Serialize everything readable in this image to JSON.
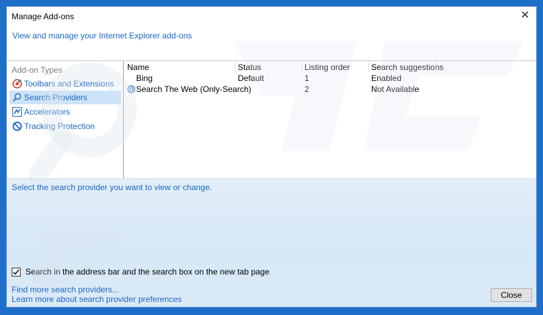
{
  "window": {
    "title": "Manage Add-ons",
    "close_glyph": "✕",
    "header_link": "View and manage your Internet Explorer add-ons"
  },
  "sidebar": {
    "heading": "Add-on Types",
    "items": [
      {
        "label": "Toolbars and Extensions",
        "icon": "toolbar-extensions-icon",
        "selected": false
      },
      {
        "label": "Search Providers",
        "icon": "search-icon",
        "selected": true
      },
      {
        "label": "Accelerators",
        "icon": "accelerator-icon",
        "selected": false
      },
      {
        "label": "Tracking Protection",
        "icon": "tracking-protection-icon",
        "selected": false
      }
    ]
  },
  "list": {
    "columns": [
      "Name",
      "Status",
      "Listing order",
      "Search suggestions"
    ],
    "rows": [
      {
        "name": "Bing",
        "status": "Default",
        "order": "1",
        "suggestions": "Enabled",
        "icon": ""
      },
      {
        "name": "Search The Web (Only-Search)",
        "status": "",
        "order": "2",
        "suggestions": "Not Available",
        "icon": "provider-globe-icon"
      }
    ]
  },
  "details": {
    "hint": "Select the search provider you want to view or change.",
    "checkbox_label": "Search in the address bar and the search box on the new tab page",
    "checkbox_checked": true
  },
  "footer": {
    "find_more": "Find more search providers...",
    "learn_more": "Learn more about search provider preferences",
    "close_label": "Close"
  },
  "colors": {
    "link": "#1c66c4",
    "selection": "#cde3f7",
    "desktop": "#1e6fc9"
  }
}
